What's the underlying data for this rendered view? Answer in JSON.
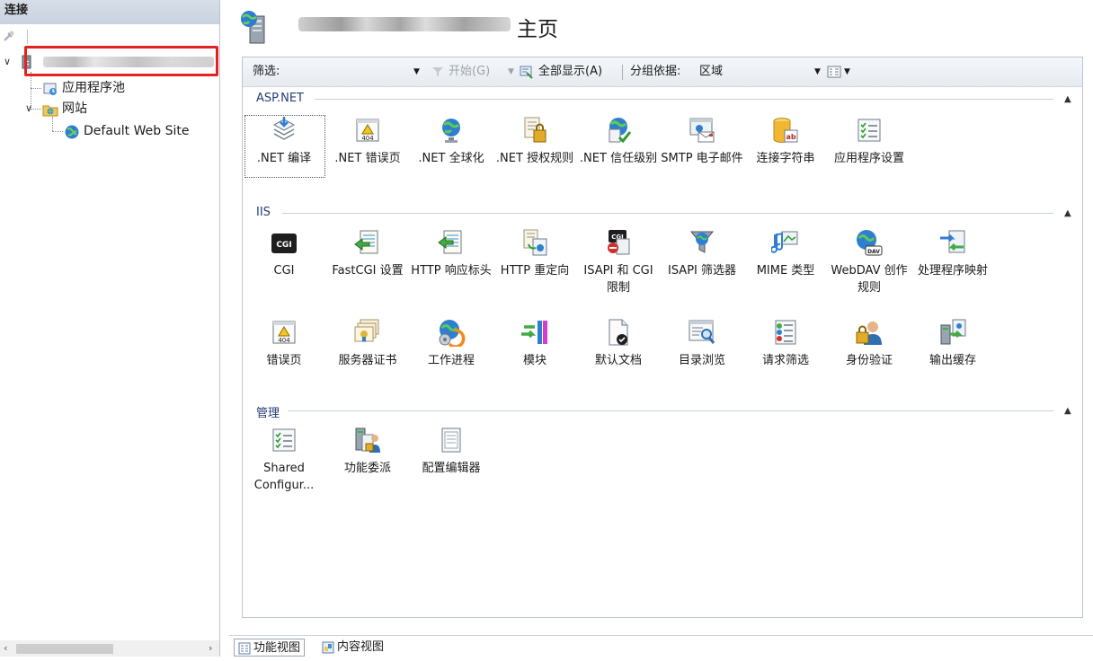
{
  "connections": {
    "header": "连接",
    "tree": {
      "app_pools": "应用程序池",
      "sites": "网站",
      "default_site": "Default Web Site"
    }
  },
  "page": {
    "title": "主页"
  },
  "filter_bar": {
    "filter_label": "筛选:",
    "go_label": "开始(G)",
    "show_all_label": "全部显示(A)",
    "group_by_label": "分组依据:",
    "group_by_value": "区域"
  },
  "groups": {
    "aspnet": {
      "title": "ASP.NET",
      "items": [
        ".NET 编译",
        ".NET 错误页",
        ".NET 全球化",
        ".NET 授权规则",
        ".NET 信任级别",
        "SMTP 电子邮件",
        "连接字符串",
        "应用程序设置"
      ]
    },
    "iis": {
      "title": "IIS",
      "items": [
        "CGI",
        "FastCGI 设置",
        "HTTP 响应标头",
        "HTTP 重定向",
        "ISAPI 和 CGI 限制",
        "ISAPI 筛选器",
        "MIME 类型",
        "WebDAV 创作规则",
        "处理程序映射",
        "错误页",
        "服务器证书",
        "工作进程",
        "模块",
        "默认文档",
        "目录浏览",
        "请求筛选",
        "身份验证",
        "输出缓存"
      ]
    },
    "management": {
      "title": "管理",
      "items": [
        "Shared Configur...",
        "功能委派",
        "配置编辑器"
      ]
    }
  },
  "tabs": {
    "features_view": "功能视图",
    "content_view": "内容视图"
  },
  "colors": {
    "highlight_box": "#e32222",
    "group_title": "#233d78"
  }
}
